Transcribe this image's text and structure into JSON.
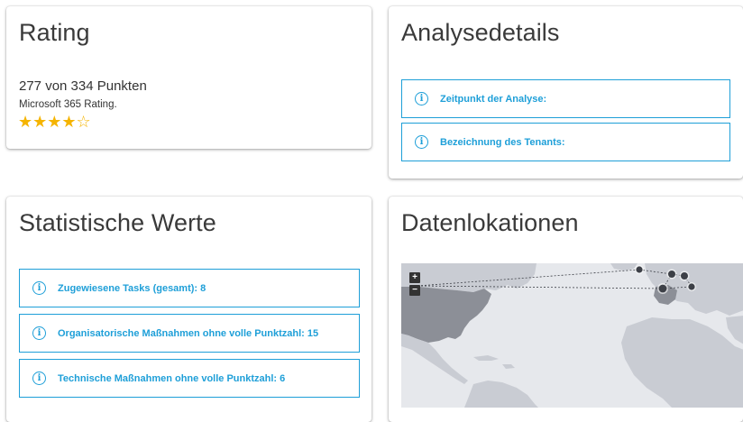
{
  "rating": {
    "title": "Rating",
    "score_text": "277 von 334 Punkten",
    "subtitle": "Microsoft 365 Rating.",
    "stars_filled": 4,
    "stars_total": 5,
    "stars_text": "★★★★☆"
  },
  "analysis": {
    "title": "Analysedetails",
    "items": [
      {
        "label": "Zeitpunkt der Analyse:"
      },
      {
        "label": "Bezeichnung des Tenants:"
      }
    ]
  },
  "stats": {
    "title": "Statistische Werte",
    "items": [
      {
        "label": "Zugewiesene Tasks (gesamt): 8"
      },
      {
        "label": "Organisatorische Maßnahmen ohne volle Punktzahl: 15"
      },
      {
        "label": "Technische Maßnahmen ohne volle Punktzahl: 6"
      }
    ]
  },
  "locations": {
    "title": "Datenlokationen",
    "zoom_in": "+",
    "zoom_out": "−",
    "icons": {
      "info": "info-circle-icon"
    }
  },
  "colors": {
    "accent": "#1e9fd8",
    "star": "#f5b400",
    "map_ocean": "#e6e8ec",
    "map_land": "#c9ccd3",
    "map_highlight": "#8c8f97",
    "marker": "#3d4047"
  }
}
